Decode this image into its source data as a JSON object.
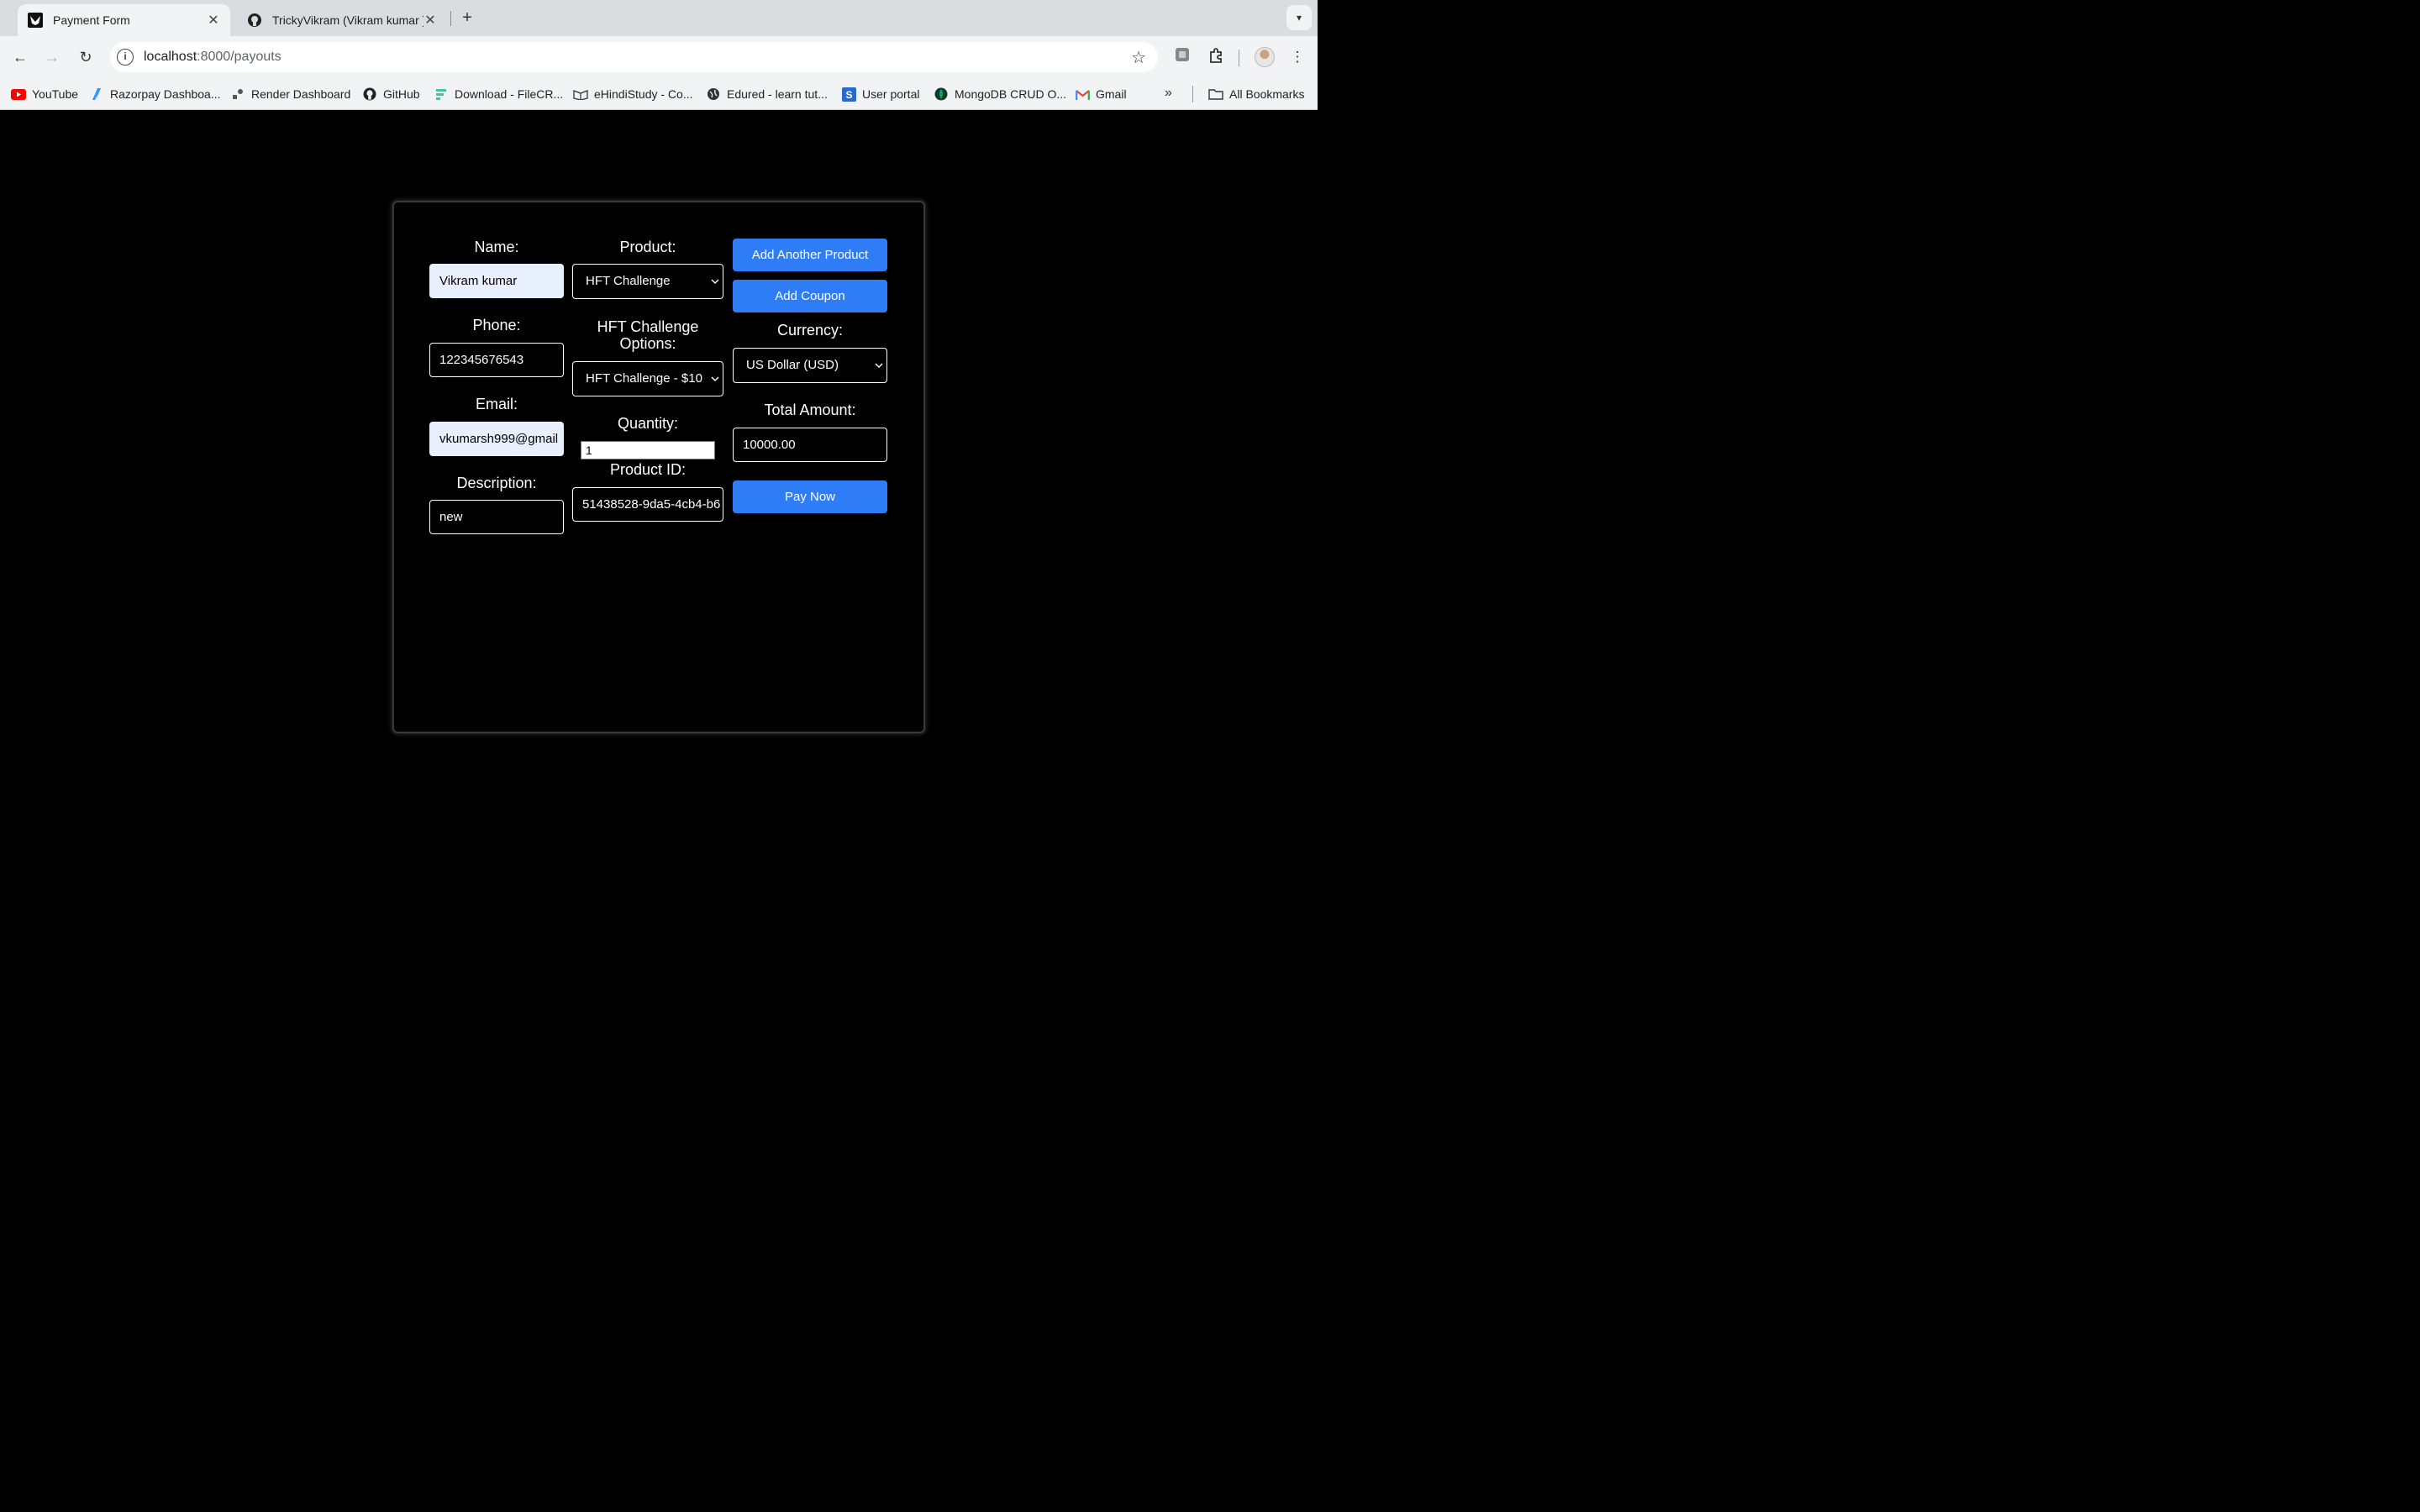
{
  "browser": {
    "tabs": [
      {
        "title": "Payment Form",
        "favicon": "owl-logo-icon",
        "active": true
      },
      {
        "title": "TrickyVikram (Vikram kumar )",
        "favicon": "github-icon",
        "active": false
      }
    ],
    "url": {
      "host": "localhost",
      "path": ":8000/payouts"
    },
    "bookmarks": [
      {
        "label": "YouTube",
        "icon": "youtube-icon",
        "color": "#ff0000"
      },
      {
        "label": "Razorpay Dashboa...",
        "icon": "razorpay-icon",
        "color": "#3395ff"
      },
      {
        "label": "Render Dashboard",
        "icon": "render-icon",
        "color": "#333333"
      },
      {
        "label": "GitHub",
        "icon": "github-icon",
        "color": "#000000"
      },
      {
        "label": "Download - FileCR...",
        "icon": "filecr-icon",
        "color": "#43c59e"
      },
      {
        "label": "eHindiStudy - Co...",
        "icon": "book-icon",
        "color": "#333333"
      },
      {
        "label": "Edured - learn tut...",
        "icon": "globe-icon",
        "color": "#333333"
      },
      {
        "label": "User portal",
        "icon": "user-portal-icon",
        "color": "#2a6bc9"
      },
      {
        "label": "MongoDB CRUD O...",
        "icon": "mongodb-icon",
        "color": "#13aa52"
      },
      {
        "label": "Gmail",
        "icon": "gmail-icon",
        "color": "#ea4335"
      }
    ],
    "all_bookmarks_label": "All Bookmarks"
  },
  "form": {
    "name_label": "Name:",
    "name_value": "Vikram kumar",
    "phone_label": "Phone:",
    "phone_value": "122345676543",
    "email_label": "Email:",
    "email_value": "vkumarsh999@gmail",
    "description_label": "Description:",
    "description_value": "new",
    "product_label": "Product:",
    "product_value": "HFT Challenge",
    "options_label": "HFT Challenge Options:",
    "options_value": "HFT Challenge - $10",
    "quantity_label": "Quantity:",
    "quantity_value": "1",
    "product_id_label": "Product ID:",
    "product_id_value": "51438528-9da5-4cb4-b6",
    "add_product_label": "Add Another Product",
    "add_coupon_label": "Add Coupon",
    "currency_label": "Currency:",
    "currency_value": "US Dollar (USD)",
    "total_label": "Total Amount:",
    "total_value": "10000.00",
    "pay_label": "Pay Now",
    "button_color": "#2f7df6"
  }
}
